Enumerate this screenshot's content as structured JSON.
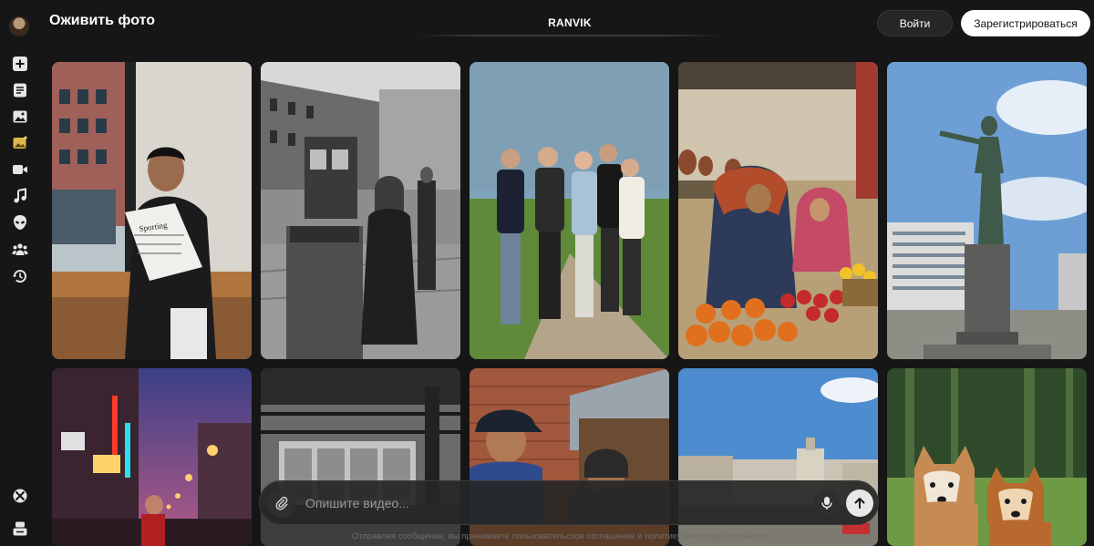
{
  "header": {
    "title": "Оживить фото",
    "center_tab": "RANVIK",
    "login_label": "Войти",
    "signup_label": "Зарегистрироваться"
  },
  "sidebar": {
    "items": [
      {
        "icon": "plus-square-icon"
      },
      {
        "icon": "document-icon"
      },
      {
        "icon": "image-icon"
      },
      {
        "icon": "image-sparkle-icon",
        "color": "#e0b94a"
      },
      {
        "icon": "video-camera-icon"
      },
      {
        "icon": "music-note-icon"
      },
      {
        "icon": "alien-face-icon"
      },
      {
        "icon": "community-icon"
      },
      {
        "icon": "history-icon"
      }
    ],
    "bottom": [
      {
        "icon": "xbox-icon"
      },
      {
        "icon": "inbox-icon"
      }
    ]
  },
  "gallery": {
    "items": [
      {
        "subject": "young man reading newspaper by window",
        "newspaper_text": "Sporting"
      },
      {
        "subject": "black and white tram street woman with cart"
      },
      {
        "subject": "group of young friends on rural road"
      },
      {
        "subject": "elderly woman and girl at fruit market"
      },
      {
        "subject": "statue on pedestal with city buildings"
      },
      {
        "subject": "neon night street with lanterns"
      },
      {
        "subject": "black and white industrial interior"
      },
      {
        "subject": "boy in cap and woman in headscarf"
      },
      {
        "subject": "city square with tower building"
      },
      {
        "subject": "two dogs in forest"
      }
    ]
  },
  "composer": {
    "placeholder": "Опишите видео...",
    "footer_note": "Отправляя сообщение, вы принимаете пользовательское соглашение и политику конфиденциальности"
  },
  "colors": {
    "background": "#161616",
    "accent_icon": "#e0b94a",
    "signup_bg": "#ffffff"
  }
}
